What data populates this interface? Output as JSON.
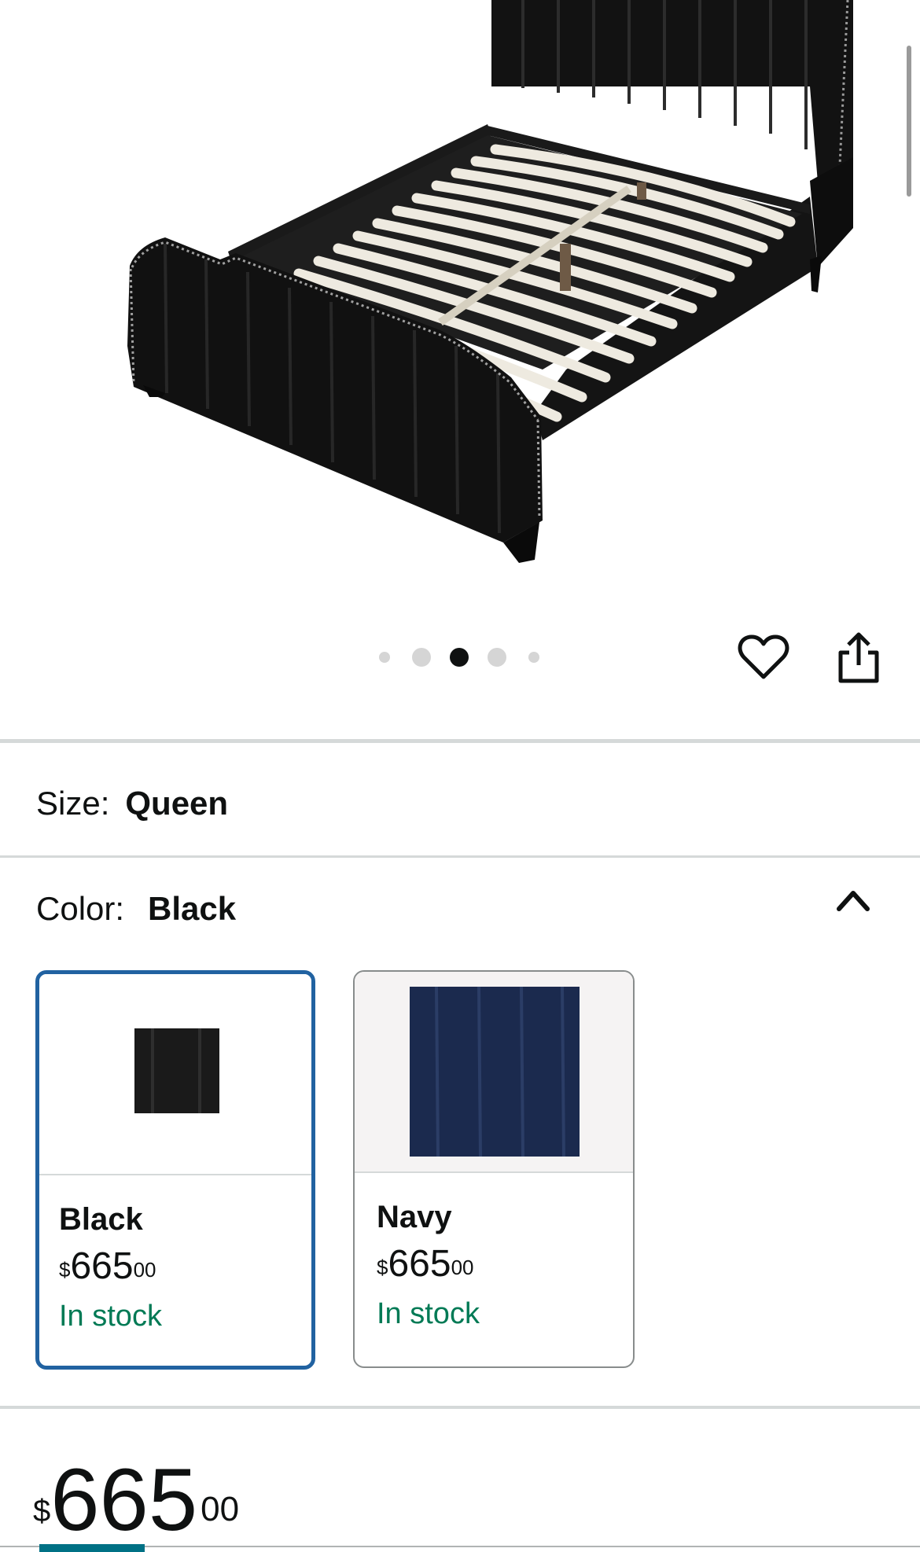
{
  "product": {
    "image_alt": "Black channel-tufted upholstered bed frame with nailhead trim"
  },
  "gallery": {
    "dot_count": 5,
    "active_index": 2
  },
  "actions": {
    "favorite_icon": "heart-icon",
    "share_icon": "share-icon"
  },
  "size": {
    "label": "Size:",
    "value": "Queen"
  },
  "color": {
    "label": "Color:",
    "value": "Black",
    "toggle_icon": "chevron-up-icon",
    "options": [
      {
        "name": "Black",
        "currency": "$",
        "price_whole": "665",
        "price_cents": "00",
        "stock": "In stock",
        "selected": true,
        "swatch_color": "#1a1a1a"
      },
      {
        "name": "Navy",
        "currency": "$",
        "price_whole": "665",
        "price_cents": "00",
        "stock": "In stock",
        "selected": false,
        "swatch_color": "#1b2a4e"
      }
    ]
  },
  "price": {
    "currency": "$",
    "whole": "665",
    "cents": "00"
  },
  "colors": {
    "selected_border": "#2162a1",
    "in_stock": "#007a55",
    "text": "#0f1111",
    "accent": "#007185"
  }
}
